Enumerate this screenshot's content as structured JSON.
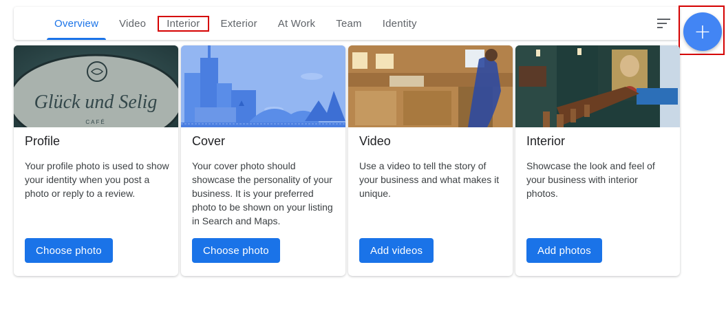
{
  "tabs": [
    {
      "label": "Overview",
      "active": true
    },
    {
      "label": "Video"
    },
    {
      "label": "Interior",
      "highlighted": true
    },
    {
      "label": "Exterior"
    },
    {
      "label": "At Work"
    },
    {
      "label": "Team"
    },
    {
      "label": "Identity"
    }
  ],
  "filter": {
    "icon": "filter-icon"
  },
  "fab": {
    "label": "+",
    "icon": "add-icon"
  },
  "cards": [
    {
      "title": "Profile",
      "text": "Your profile photo is used to show your identity when you post a photo or reply to a review.",
      "button": "Choose photo",
      "sign_text": "Glück und Selig",
      "sign_sub": "CAFÉ"
    },
    {
      "title": "Cover",
      "text": "Your cover photo should showcase the personality of your business. It is your preferred photo to be shown on your listing in Search and Maps.",
      "button": "Choose photo"
    },
    {
      "title": "Video",
      "text": "Use a video to tell the story of your business and what makes it unique.",
      "button": "Add videos"
    },
    {
      "title": "Interior",
      "text": "Showcase the look and feel of your business with interior photos.",
      "button": "Add photos"
    }
  ],
  "colors": {
    "accent": "#1a73e8",
    "fab": "#4285f4",
    "highlight": "#d50000"
  }
}
